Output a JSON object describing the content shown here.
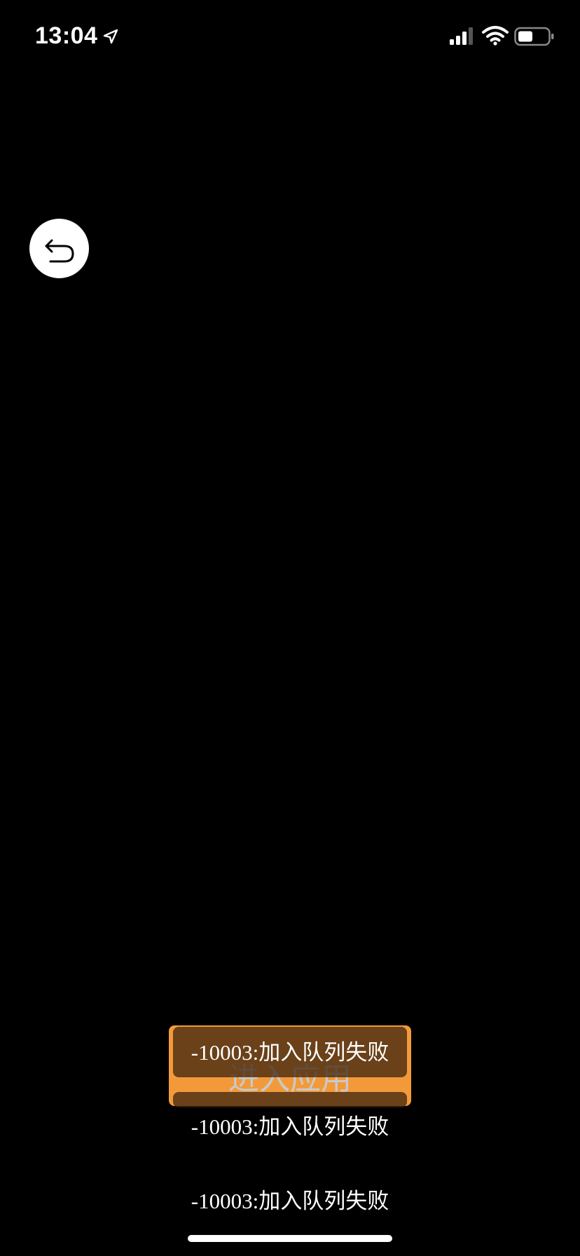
{
  "status_bar": {
    "time": "13:04",
    "icons": [
      "location-arrow-icon",
      "signal-icon",
      "wifi-icon",
      "battery-icon"
    ]
  },
  "back_button": {
    "icon": "back-arrow-icon"
  },
  "enter_button": {
    "label": "进入应用",
    "color": "#f29a3a"
  },
  "toasts": [
    "-10003:加入队列失败",
    "-10003:加入队列失败",
    "-10003:加入队列失败"
  ],
  "colors": {
    "background": "#000000",
    "accent": "#f29a3a",
    "toast_bg": "#3c230f"
  }
}
